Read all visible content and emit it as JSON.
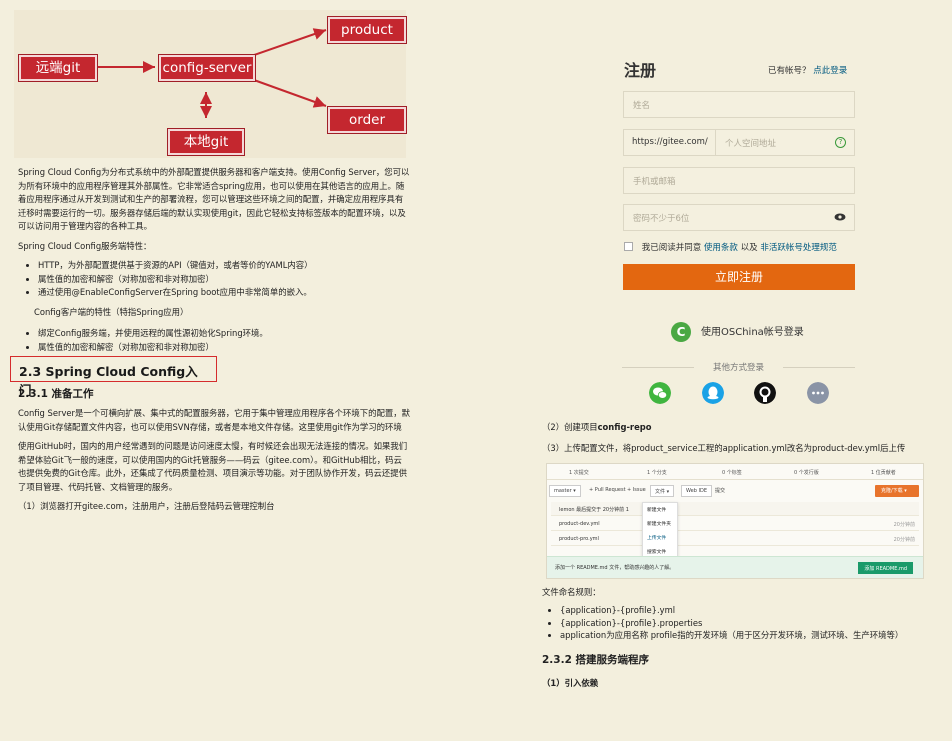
{
  "diagram": {
    "remote_git": "远端git",
    "config_server": "config-server",
    "local_git": "本地git",
    "product": "product",
    "order": "order"
  },
  "left": {
    "intro": "Spring Cloud Config为分布式系统中的外部配置提供服务器和客户端支持。使用Config Server，您可以为所有环境中的应用程序管理其外部属性。它非常适合spring应用，也可以使用在其他语言的应用上。随着应用程序通过从开发到测试和生产的部署流程，您可以管理这些环境之间的配置，并确定应用程序具有迁移时需要运行的一切。服务器存储后端的默认实现使用git，因此它轻松支持标签版本的配置环境，以及可以访问用于管理内容的各种工具。",
    "server_features_title": "Spring Cloud Config服务端特性：",
    "server_features": [
      "HTTP，为外部配置提供基于资源的API（键值对，或者等价的YAML内容）",
      "属性值的加密和解密（对称加密和非对称加密）",
      "通过使用@EnableConfigServer在Spring boot应用中非常简单的嵌入。"
    ],
    "client_features_title": "Config客户端的特性（特指Spring应用）",
    "client_features": [
      "绑定Config服务端，并使用远程的属性源初始化Spring环境。",
      "属性值的加密和解密（对称加密和非对称加密）"
    ],
    "section_heading": "2.3 Spring Cloud Config入门",
    "sub_heading": "2.3.1 准备工作",
    "para1": "Config Server是一个可横向扩展、集中式的配置服务器，它用于集中管理应用程序各个环境下的配置，默认使用Git存储配置文件内容，也可以使用SVN存储，或者是本地文件存储。这里使用git作为学习的环境",
    "para2": "使用GitHub时，国内的用户经常遇到的问题是访问速度太慢，有时候还会出现无法连接的情况。如果我们希望体验Git飞一般的速度，可以使用国内的Git托管服务——码云（gitee.com）。和GitHub相比，码云也提供免费的Git仓库。此外，还集成了代码质量检测、项目演示等功能。对于团队协作开发，码云还提供了项目管理、代码托管、文档管理的服务。",
    "step1": "（1）浏览器打开gitee.com，注册用户，注册后登陆码云管理控制台"
  },
  "register": {
    "title": "注册",
    "have_account": "已有帐号？",
    "login_link": "点此登录",
    "name_placeholder": "姓名",
    "url_prefix": "https://gitee.com/",
    "space_placeholder": "个人空间地址",
    "phone_placeholder": "手机或邮箱",
    "password_placeholder": "密码不少于6位",
    "agree_text": "我已阅读并同意",
    "terms_link": "使用条款",
    "and": "以及",
    "illegal_link": "非活跃帐号处理规范",
    "submit": "立即注册",
    "oschina_login": "使用OSChina帐号登录",
    "other_methods": "其他方式登录",
    "colors": {
      "accent": "#e36710",
      "link": "#005980"
    },
    "social_icons": [
      "wechat-icon",
      "qq-icon",
      "github-icon",
      "more-icon"
    ]
  },
  "right": {
    "step2_prefix": "（2）创建项目",
    "step2_bold": "config-repo",
    "step3": "（3）上传配置文件，将product_service工程的application.yml改名为product-dev.yml后上传",
    "naming_title": "文件命名规则：",
    "naming_items": [
      "{application}-{profile}.yml",
      "{application}-{profile}.properties",
      "application为应用名称 profile指的开发环境（用于区分开发环境，测试环境、生产环境等）"
    ],
    "sub_heading2": "2.3.2 搭建服务端程序",
    "step_intro": "（1）引入依赖"
  },
  "gitee": {
    "stats": [
      "1 次提交",
      "1 个分支",
      "0 个标签",
      "0 个发行版",
      "1 位贡献者"
    ],
    "branch": "master ▾",
    "pull_request": "+ Pull Request",
    "issue": "+ Issue",
    "file_btn": "文件 ▾",
    "webide": "Web IDE",
    "wiki": "提交",
    "clone": "克隆/下载 ▾",
    "commit_row": "lemon 最后提交于 20分钟前 1",
    "files": [
      {
        "name": "product-dev.yml",
        "time": "20分钟前"
      },
      {
        "name": "product-pro.yml",
        "time": "20分钟前"
      }
    ],
    "menu": [
      "新建文件",
      "新建文件夹",
      "上传文件",
      "搜索文件"
    ],
    "readme_tip": "添加一个 README.md 文件，帮助感兴趣的人了解。",
    "readme_btn": "添加 README.md"
  }
}
